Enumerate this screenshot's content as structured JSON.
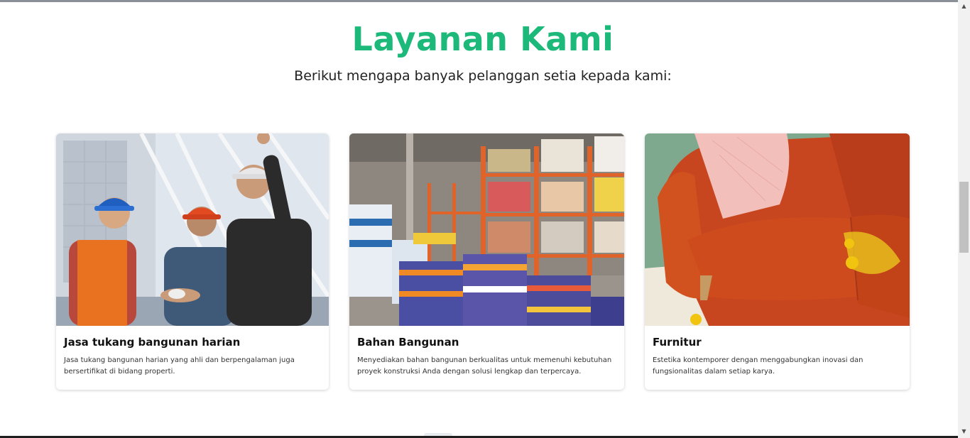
{
  "section": {
    "title": "Layanan Kami",
    "subtitle": "Berikut mengapa banyak pelanggan setia kepada kami:"
  },
  "services": [
    {
      "title": "Jasa tukang bangunan harian",
      "description": "Jasa tukang bangunan harian yang ahli dan berpengalaman juga bersertifikat di bidang properti.",
      "image": "construction-workers-handshake-photo"
    },
    {
      "title": "Bahan Bangunan",
      "description": "Menyediakan bahan bangunan berkualitas untuk memenuhi kebutuhan proyek konstruksi Anda dengan solusi lengkap dan terpercaya.",
      "image": "building-materials-warehouse-photo"
    },
    {
      "title": "Furnitur",
      "description": "Estetika kontemporer dengan menggabungkan inovasi dan fungsionalitas dalam setiap karya.",
      "image": "orange-sofa-photo"
    }
  ],
  "colors": {
    "accent": "#1db97a",
    "sofa": "#c8461f",
    "warehouse_shelf": "#e0642a",
    "page_background": "#ffffff"
  },
  "scrollbar": {
    "up_icon": "scroll-up-arrow-icon",
    "down_icon": "scroll-down-arrow-icon"
  }
}
